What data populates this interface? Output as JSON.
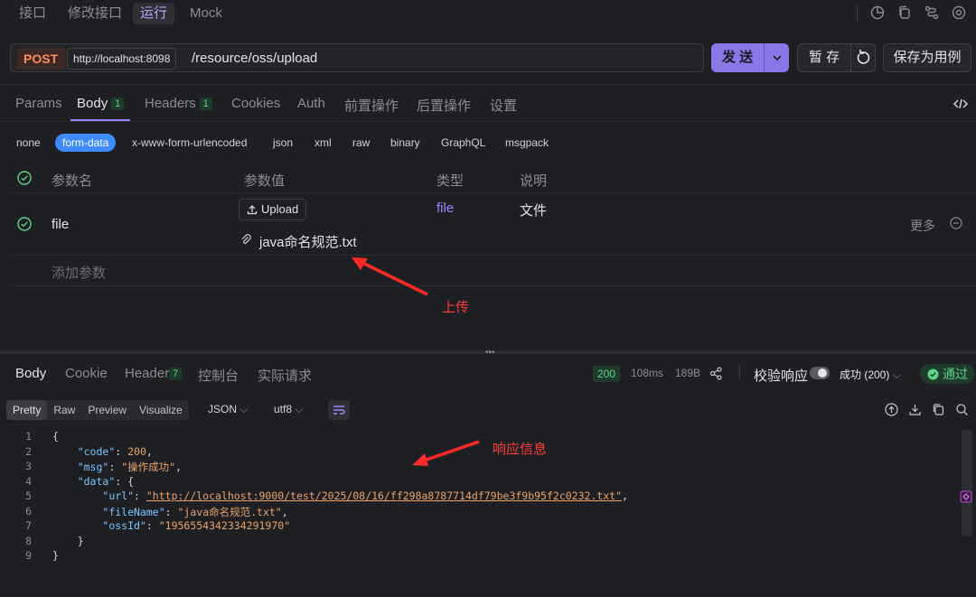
{
  "top_tabs": [
    {
      "label": "接口"
    },
    {
      "label": "修改接口"
    },
    {
      "label": "运行"
    },
    {
      "label": "Mock"
    }
  ],
  "request": {
    "method": "POST",
    "host": "http://localhost:8098",
    "path": "/resource/oss/upload",
    "send_label": "发 送",
    "save_draft_label": "暂 存",
    "save_case_label": "保存为用例"
  },
  "request_tabs": [
    {
      "label": "Params",
      "badge": ""
    },
    {
      "label": "Body",
      "badge": "1"
    },
    {
      "label": "Headers",
      "badge": "1"
    },
    {
      "label": "Cookies",
      "badge": ""
    },
    {
      "label": "Auth",
      "badge": ""
    },
    {
      "label": "前置操作",
      "badge": ""
    },
    {
      "label": "后置操作",
      "badge": ""
    },
    {
      "label": "设置",
      "badge": ""
    }
  ],
  "body_types": [
    "none",
    "form-data",
    "x-www-form-urlencoded",
    "json",
    "xml",
    "raw",
    "binary",
    "GraphQL",
    "msgpack"
  ],
  "params": {
    "headers": [
      "参数名",
      "参数值",
      "类型",
      "说明"
    ],
    "row": {
      "name": "file",
      "upload_label": "Upload",
      "file_name": "java命名规范.txt",
      "type": "file",
      "desc": "文件",
      "more": "更多"
    },
    "add_label": "添加参数"
  },
  "annotations": {
    "upload": "上传",
    "response": "响应信息"
  },
  "response": {
    "tabs": [
      {
        "label": "Body",
        "badge": ""
      },
      {
        "label": "Cookie",
        "badge": ""
      },
      {
        "label": "Header",
        "badge": "7"
      },
      {
        "label": "控制台",
        "badge": ""
      },
      {
        "label": "实际请求",
        "badge": ""
      }
    ],
    "status": "200",
    "time": "108ms",
    "size": "189B",
    "validate_label": "校验响应",
    "result_select": "成功 (200)",
    "pass_label": "通过",
    "view_modes": [
      "Pretty",
      "Raw",
      "Preview",
      "Visualize"
    ],
    "format": "JSON",
    "encoding": "utf8",
    "line_numbers": [
      "1",
      "2",
      "3",
      "4",
      "5",
      "6",
      "7",
      "8",
      "9"
    ],
    "json": {
      "code": "200",
      "msg": "\"操作成功\"",
      "url": "\"http://localhost:9000/test/2025/08/16/ff298a8787714df79be3f9b95f2c0232.txt\"",
      "fileName": "\"java命名规范.txt\"",
      "ossId": "\"1956554342334291970\""
    }
  },
  "colors": {
    "accent": "#8b76e8",
    "method": "#ff8a5c",
    "success": "#5fd38a",
    "annotation": "#ff3b3b"
  }
}
